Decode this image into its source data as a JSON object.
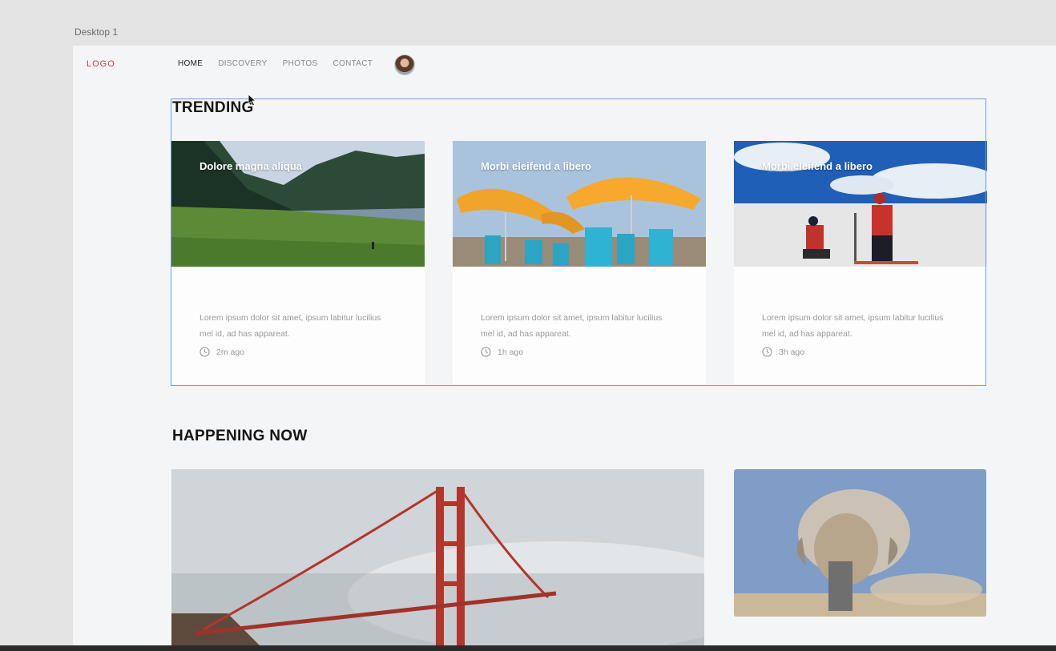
{
  "frame": {
    "label": "Desktop 1"
  },
  "header": {
    "logo": "LOGO",
    "nav": [
      {
        "label": "HOME",
        "active": true
      },
      {
        "label": "DISCOVERY",
        "active": false
      },
      {
        "label": "PHOTOS",
        "active": false
      },
      {
        "label": "CONTACT",
        "active": false
      }
    ]
  },
  "trending": {
    "title": "TRENDING",
    "cards": [
      {
        "title": "Dolore magna aliqua",
        "description": "Lorem ipsum dolor sit amet, ipsum labitur lucilius mel id, ad has appareat.",
        "time": "2m ago",
        "image": "mountain-lake-image"
      },
      {
        "title": "Morbi eleifend a libero",
        "description": "Lorem ipsum dolor sit amet, ipsum labitur lucilius mel id, ad has appareat.",
        "time": "1h ago",
        "image": "beach-umbrellas-image"
      },
      {
        "title": "Morbi eleifend a libero",
        "description": "Lorem ipsum dolor sit amet, ipsum labitur lucilius mel id, ad has appareat.",
        "time": "3h ago",
        "image": "snow-explorers-image"
      }
    ]
  },
  "happening": {
    "title": "HAPPENING NOW",
    "images": [
      "golden-gate-bridge-image",
      "elephant-dust-image"
    ]
  },
  "colors": {
    "logo": "#d0353f",
    "selection": "#6d9ee6",
    "background": "#f4f5f6"
  }
}
